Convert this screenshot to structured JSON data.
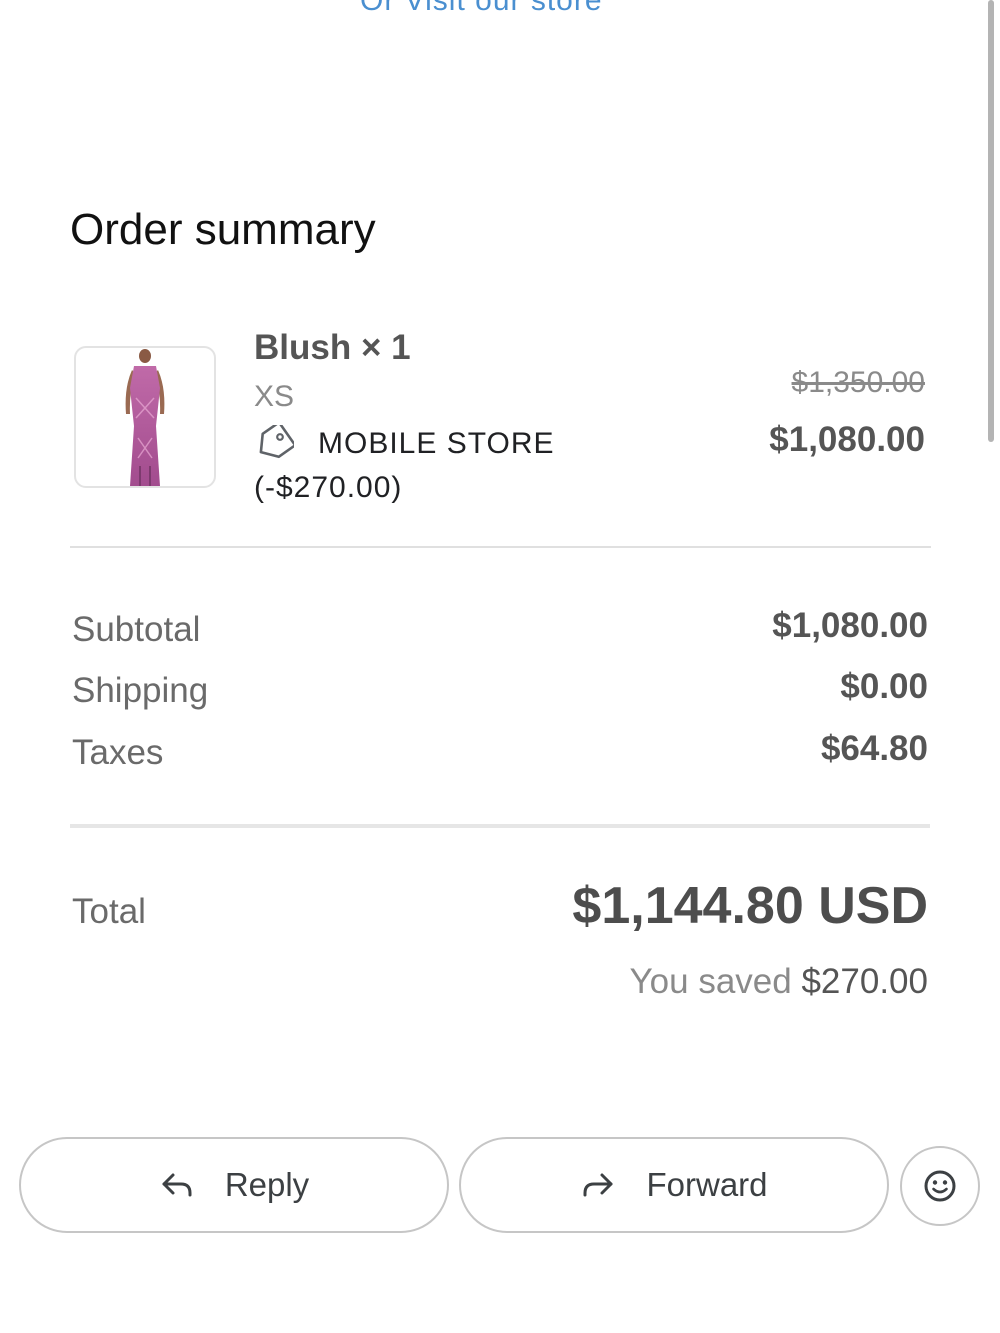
{
  "top_link": "Or Visit our store",
  "order_summary": {
    "title": "Order summary",
    "item": {
      "name": "Blush × 1",
      "variant": "XS",
      "discount": "MOBILE STORE (-$270.00)",
      "original_price": "$1,350.00",
      "final_price": "$1,080.00",
      "image_icon": "dress-image"
    },
    "rows": [
      {
        "label": "Subtotal",
        "value": "$1,080.00"
      },
      {
        "label": "Shipping",
        "value": "$0.00"
      },
      {
        "label": "Taxes",
        "value": "$64.80"
      }
    ],
    "total": {
      "label": "Total",
      "value": "$1,144.80 USD",
      "saved_label": "You saved",
      "saved_amount": "$270.00"
    }
  },
  "actions": {
    "reply_label": "Reply",
    "forward_label": "Forward",
    "reply_icon": "reply-arrow-icon",
    "forward_icon": "forward-arrow-icon",
    "emoji_icon": "smiley-icon"
  },
  "colors": {
    "link": "#4a8fd0",
    "muted_text": "#8a8a8a",
    "strong_text": "#555555"
  }
}
